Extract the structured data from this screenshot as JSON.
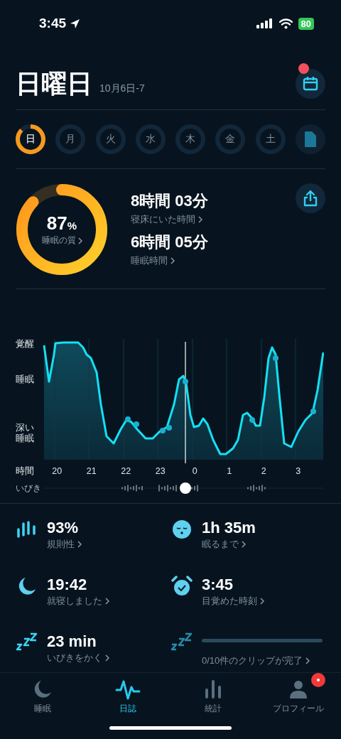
{
  "status_bar": {
    "time": "3:45",
    "battery": "80"
  },
  "header": {
    "title": "日曜日",
    "subtitle": "10月6日-7",
    "calendar_badge": true
  },
  "days": [
    {
      "label": "日",
      "selected": true,
      "level": 0.87
    },
    {
      "label": "月",
      "selected": false
    },
    {
      "label": "火",
      "selected": false
    },
    {
      "label": "水",
      "selected": false
    },
    {
      "label": "木",
      "selected": false
    },
    {
      "label": "金",
      "selected": false
    },
    {
      "label": "土",
      "selected": false
    }
  ],
  "summary": {
    "quality": {
      "value": "87",
      "unit": "%",
      "label": "睡眠の質",
      "level": 0.87
    },
    "metrics": [
      {
        "value": "8時間 03分",
        "label": "寝床にいた時間"
      },
      {
        "value": "6時間 05分",
        "label": "睡眠時間"
      }
    ]
  },
  "hypnogram": {
    "y_labels": [
      "覚醒",
      "睡眠",
      "深い睡眠"
    ],
    "x_title": "時間",
    "x_ticks": [
      "20",
      "21",
      "22",
      "23",
      "0",
      "1",
      "2",
      "3"
    ],
    "snore_label": "いびき"
  },
  "stats": [
    {
      "kind": "value",
      "value": "93%",
      "label": "規則性"
    },
    {
      "kind": "value",
      "value": "1h 35m",
      "label": "眠るまで"
    },
    {
      "kind": "value",
      "value": "19:42",
      "label": "就寝しました"
    },
    {
      "kind": "value",
      "value": "3:45",
      "label": "目覚めた時刻"
    },
    {
      "kind": "value",
      "value": "23 min",
      "label": "いびきをかく"
    },
    {
      "kind": "progress",
      "level": 0,
      "label": "0/10件のクリップが完了"
    }
  ],
  "tabs": [
    {
      "label": "睡眠",
      "selected": false,
      "badge": false
    },
    {
      "label": "日誌",
      "selected": true,
      "badge": false
    },
    {
      "label": "統計",
      "selected": false,
      "badge": false
    },
    {
      "label": "プロフィール",
      "selected": false,
      "badge": true
    }
  ]
}
